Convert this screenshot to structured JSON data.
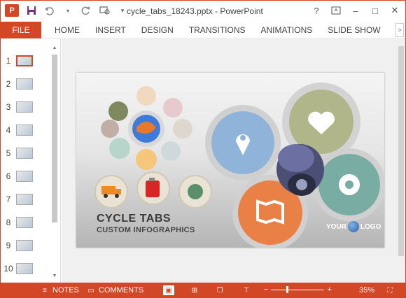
{
  "window": {
    "title": "cycle_tabs_18243.pptx - PowerPoint",
    "app_logo": "P",
    "controls": {
      "help": "?",
      "restore_icon": "ribbon-display-icon",
      "minimize": "–",
      "maximize": "□",
      "close": "✕"
    }
  },
  "qat": {
    "save_icon": "save-icon",
    "undo_icon": "undo-icon",
    "redo_icon": "redo-icon",
    "present_icon": "present-icon",
    "more_icon": "chevron-down-icon"
  },
  "ribbon": {
    "file_label": "FILE",
    "tabs": [
      "HOME",
      "INSERT",
      "DESIGN",
      "TRANSITIONS",
      "ANIMATIONS",
      "SLIDE SHOW"
    ]
  },
  "thumbnails": {
    "active_index": 0,
    "items": [
      "1",
      "2",
      "3",
      "4",
      "5",
      "6",
      "7",
      "8",
      "9",
      "10"
    ]
  },
  "slide": {
    "title": "CYCLE TABS",
    "subtitle": "CUSTOM INFOGRAPHICS",
    "logo_left": "YOUR",
    "logo_right": "LOGO"
  },
  "statusbar": {
    "notes_label": "NOTES",
    "comments_label": "COMMENTS",
    "zoom_minus": "−",
    "zoom_plus": "+",
    "zoom_level": "35%",
    "zoom_fraction": 0.3
  },
  "colors": {
    "accent": "#d24726",
    "petal_blue": "#8fb3d9",
    "petal_olive": "#b1b58a",
    "petal_teal": "#79ada3",
    "petal_orange": "#e98146"
  }
}
